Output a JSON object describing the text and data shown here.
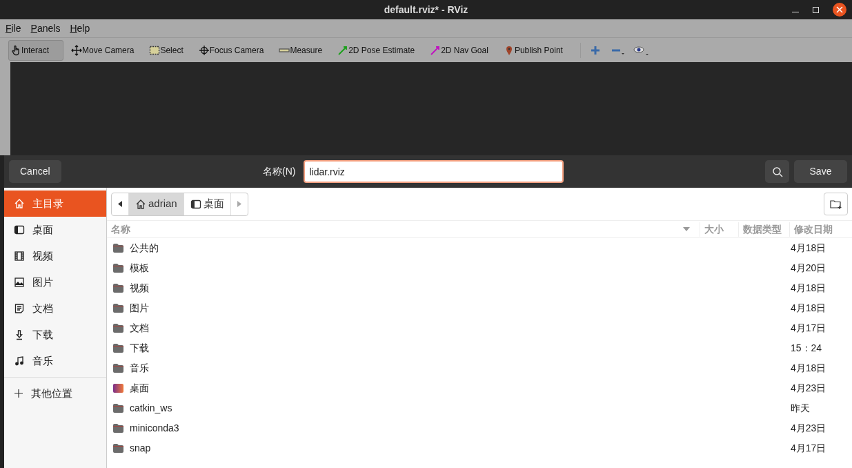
{
  "window": {
    "title": "default.rviz* - RViz"
  },
  "menu": [
    "File",
    "Panels",
    "Help"
  ],
  "tools": [
    {
      "label": "Interact",
      "kind": "interact",
      "selected": true
    },
    {
      "label": "Move Camera",
      "kind": "move",
      "selected": false
    },
    {
      "label": "Select",
      "kind": "select",
      "selected": false
    },
    {
      "label": "Focus Camera",
      "kind": "focus",
      "selected": false
    },
    {
      "label": "Measure",
      "kind": "measure",
      "selected": false
    },
    {
      "label": "2D Pose Estimate",
      "kind": "pose",
      "selected": false
    },
    {
      "label": "2D Nav Goal",
      "kind": "goal",
      "selected": false
    },
    {
      "label": "Publish Point",
      "kind": "point",
      "selected": false
    }
  ],
  "dialog": {
    "cancel": "Cancel",
    "name_label": "名称(N)",
    "name_value": "lidar.rviz",
    "save": "Save",
    "sidebar": [
      {
        "label": "主目录",
        "kind": "home",
        "selected": true
      },
      {
        "label": "桌面",
        "kind": "desktop",
        "selected": false
      },
      {
        "label": "视频",
        "kind": "video",
        "selected": false
      },
      {
        "label": "图片",
        "kind": "picture",
        "selected": false
      },
      {
        "label": "文档",
        "kind": "document",
        "selected": false
      },
      {
        "label": "下载",
        "kind": "download",
        "selected": false
      },
      {
        "label": "音乐",
        "kind": "music",
        "selected": false
      }
    ],
    "other_locations": "其他位置",
    "path": [
      {
        "label": "adrian",
        "kind": "home",
        "selected": true
      },
      {
        "label": "桌面",
        "kind": "desktop",
        "selected": false
      }
    ],
    "columns": [
      "名称",
      "大小",
      "数据类型",
      "修改日期"
    ],
    "rows": [
      {
        "name": "公共的",
        "kind": "folder",
        "modified": "4月18日"
      },
      {
        "name": "模板",
        "kind": "folder",
        "modified": "4月20日"
      },
      {
        "name": "视频",
        "kind": "folder",
        "modified": "4月18日"
      },
      {
        "name": "图片",
        "kind": "folder",
        "modified": "4月18日"
      },
      {
        "name": "文档",
        "kind": "folder",
        "modified": "4月17日"
      },
      {
        "name": "下载",
        "kind": "folder",
        "modified": "15：24"
      },
      {
        "name": "音乐",
        "kind": "folder",
        "modified": "4月18日"
      },
      {
        "name": "桌面",
        "kind": "desktop",
        "modified": "4月23日"
      },
      {
        "name": "catkin_ws",
        "kind": "folder",
        "modified": "昨天"
      },
      {
        "name": "miniconda3",
        "kind": "folder",
        "modified": "4月23日"
      },
      {
        "name": "snap",
        "kind": "folder",
        "modified": "4月17日"
      }
    ]
  }
}
